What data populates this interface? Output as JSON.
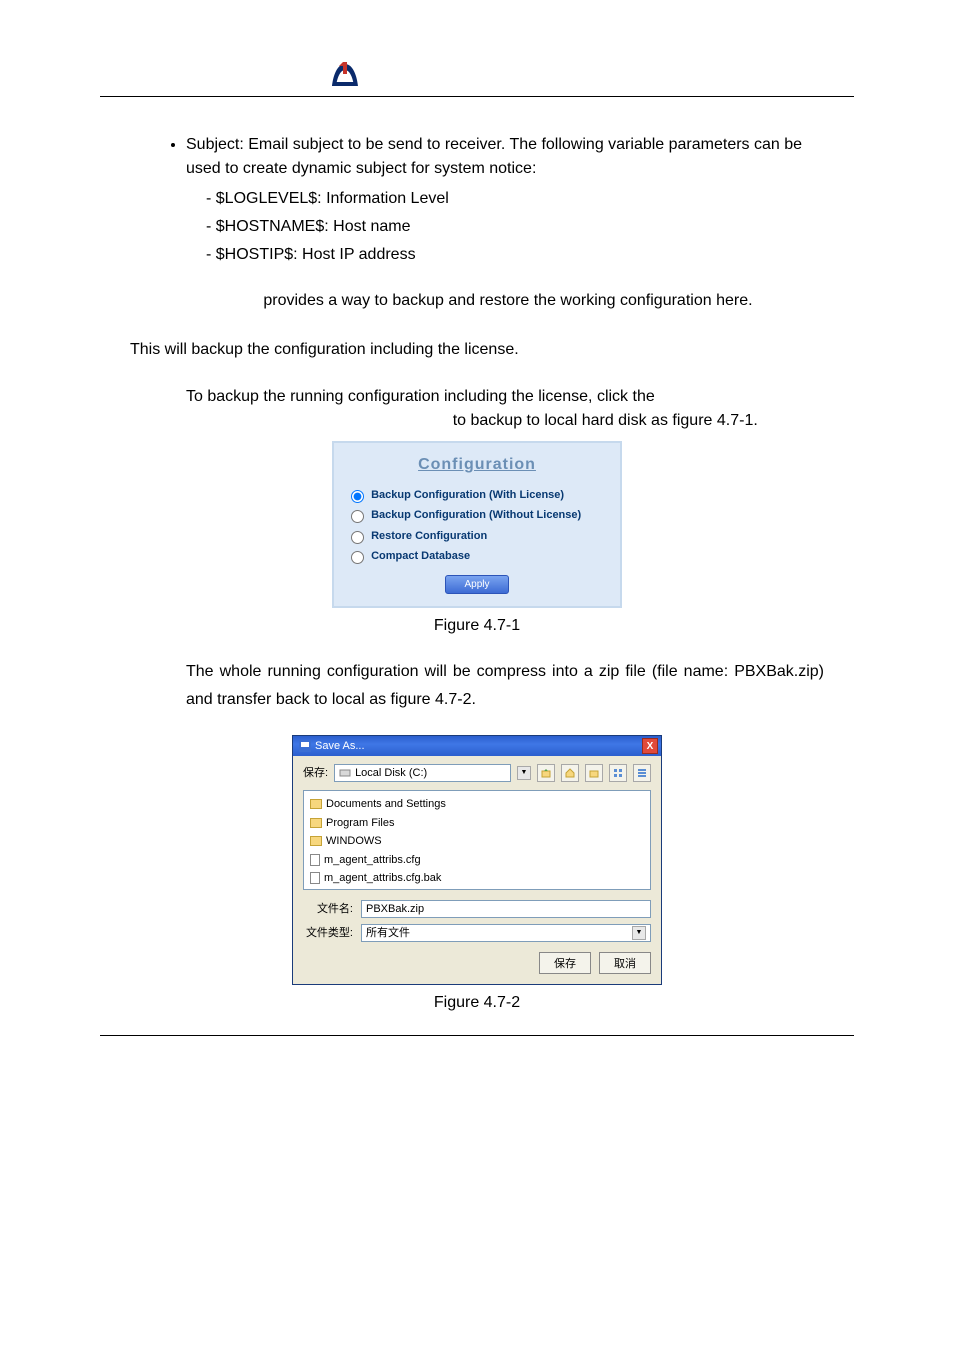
{
  "bullets": {
    "subject": "Subject: Email subject to be send to receiver. The following variable parameters can be used to create dynamic subject for system notice:",
    "sub1": "$LOGLEVEL$: Information Level",
    "sub2": "$HOSTNAME$: Host name",
    "sub3": "$HOSTIP$: Host IP address"
  },
  "body": {
    "para1": "                              provides a way to backup and restore the working configuration here.",
    "para2": "This will backup the configuration including the license.",
    "para3a": "To backup the running configuration including the license, click the",
    "para3b": "                                                            to backup to local hard disk as figure 4.7-1.",
    "fig1": "Figure 4.7-1",
    "para4": "The whole running configuration will be compress into a zip file (file name: PBXBak.zip) and transfer back to local as figure 4.7-2.",
    "fig2": "Figure 4.7-2"
  },
  "config": {
    "title": "Configuration",
    "opt1": "Backup Configuration (With License)",
    "opt2": "Backup Configuration (Without License)",
    "opt3": "Restore Configuration",
    "opt4": "Compact Database",
    "apply": "Apply"
  },
  "saveas": {
    "title": "Save As...",
    "close": "X",
    "savein_label": "保存:",
    "drive": "Local Disk (C:)",
    "items": {
      "docs": "Documents and Settings",
      "pf": "Program Files",
      "win": "WINDOWS",
      "f1": "m_agent_attribs.cfg",
      "f2": "m_agent_attribs.cfg.bak"
    },
    "filename_label": "文件名:",
    "filename_value": "PBXBak.zip",
    "filetype_label": "文件类型:",
    "filetype_value": "所有文件",
    "save_btn": "保存",
    "cancel_btn": "取消"
  }
}
